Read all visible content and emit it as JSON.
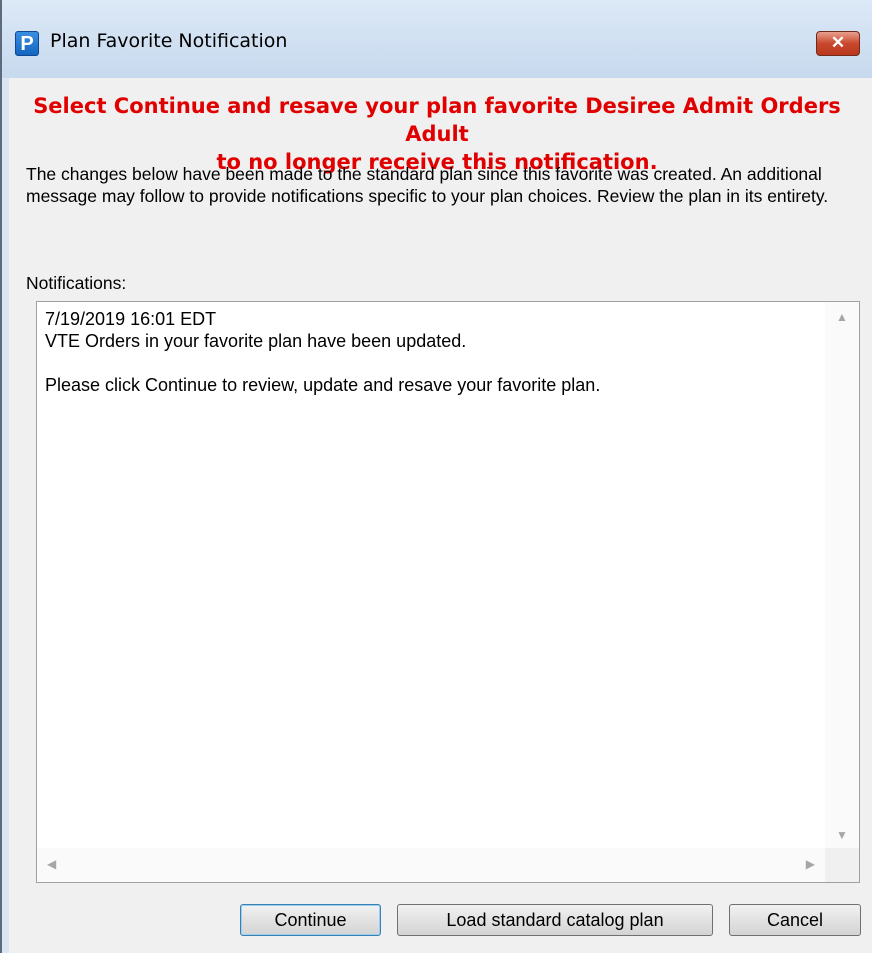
{
  "window": {
    "app_icon_letter": "P",
    "title": "Plan Favorite Notification",
    "close_glyph": "✕"
  },
  "dialog": {
    "headline_line1": "Select Continue and resave your plan favorite Desiree Admit Orders Adult",
    "headline_line2": "to no longer receive this notification.",
    "description": "The changes below have been made to the standard plan since this favorite was created. An additional message may follow to provide notifications specific to your plan choices. Review the plan in its entirety.",
    "notifications_label": "Notifications:",
    "notifications": {
      "line1": "7/19/2019 16:01 EDT",
      "line2": "VTE Orders in your favorite plan have been updated.",
      "line3": "",
      "line4": "Please click Continue to review, update and resave your favorite plan."
    }
  },
  "buttons": {
    "continue": "Continue",
    "load_standard": "Load standard catalog plan",
    "cancel": "Cancel"
  },
  "colors": {
    "headline": "#e00000",
    "titlebar": "#c7d9ee",
    "close_button": "#c9482e"
  },
  "icons": {
    "app": "plan-p-icon",
    "close": "close-icon",
    "scroll_up": "arrow-up-icon",
    "scroll_down": "arrow-down-icon",
    "scroll_left": "arrow-left-icon",
    "scroll_right": "arrow-right-icon"
  }
}
